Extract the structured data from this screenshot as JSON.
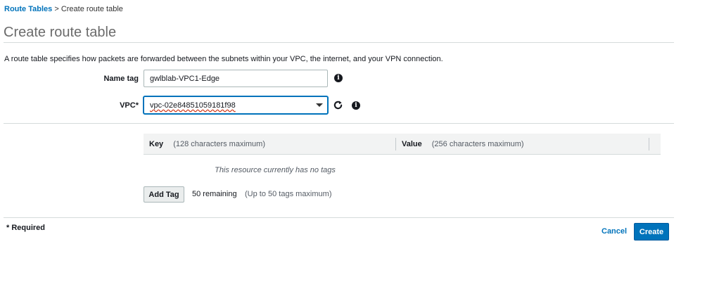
{
  "breadcrumb": {
    "parent": "Route Tables",
    "separator": ">",
    "current": "Create route table"
  },
  "page": {
    "title": "Create route table",
    "description": "A route table specifies how packets are forwarded between the subnets within your VPC, the internet, and your VPN connection."
  },
  "form": {
    "name_tag_label": "Name tag",
    "name_tag_value": "gwlblab-VPC1-Edge",
    "vpc_label": "VPC*",
    "vpc_value": "vpc-02e84851059181f98",
    "info_icon_glyph": "i"
  },
  "tags": {
    "key_header": "Key",
    "key_hint": "(128 characters maximum)",
    "value_header": "Value",
    "value_hint": "(256 characters maximum)",
    "empty_message": "This resource currently has no tags",
    "add_button": "Add Tag",
    "remaining": "50 remaining",
    "max_note": "(Up to 50 tags maximum)"
  },
  "footer": {
    "required_note": "* Required",
    "cancel_label": "Cancel",
    "create_label": "Create"
  },
  "colors": {
    "accent": "#0073bb",
    "error_underline": "#d13212",
    "header_bg": "#f2f3f3"
  },
  "icons": {
    "info": "info-icon",
    "refresh": "refresh-icon",
    "dropdown": "chevron-down-icon"
  }
}
